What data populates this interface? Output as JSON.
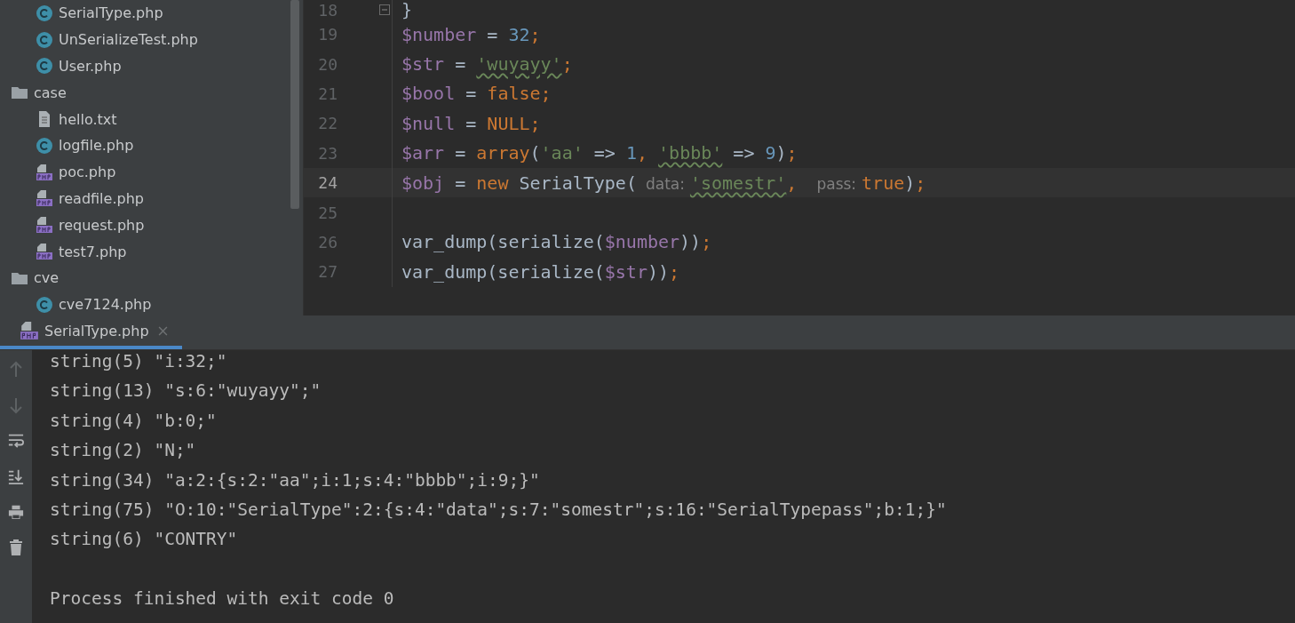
{
  "project_tree": [
    {
      "name": "SerialType.php",
      "kind": "class"
    },
    {
      "name": "UnSerializeTest.php",
      "kind": "class"
    },
    {
      "name": "User.php",
      "kind": "class"
    },
    {
      "name": "case",
      "kind": "folder",
      "children": [
        {
          "name": "hello.txt",
          "kind": "text"
        },
        {
          "name": "logfile.php",
          "kind": "class"
        },
        {
          "name": "poc.php",
          "kind": "php"
        },
        {
          "name": "readfile.php",
          "kind": "php"
        },
        {
          "name": "request.php",
          "kind": "php"
        },
        {
          "name": "test7.php",
          "kind": "php"
        }
      ]
    },
    {
      "name": "cve",
      "kind": "folder",
      "children": [
        {
          "name": "cve7124.php",
          "kind": "class"
        }
      ]
    }
  ],
  "editor": {
    "lines": [
      {
        "number": "18",
        "current": false,
        "tokens": [
          {
            "kind": "op",
            "text": "}"
          }
        ]
      },
      {
        "number": "19",
        "current": false,
        "tokens": [
          {
            "kind": "var",
            "text": "$number"
          },
          {
            "kind": "op",
            "text": " = "
          },
          {
            "kind": "num",
            "text": "32"
          },
          {
            "kind": "kw",
            "text": ";"
          }
        ]
      },
      {
        "number": "20",
        "current": false,
        "tokens": [
          {
            "kind": "var",
            "text": "$str"
          },
          {
            "kind": "op",
            "text": " = "
          },
          {
            "kind": "str",
            "text": "'wuyayy'",
            "typo": true
          },
          {
            "kind": "kw",
            "text": ";"
          }
        ]
      },
      {
        "number": "21",
        "current": false,
        "tokens": [
          {
            "kind": "var",
            "text": "$bool"
          },
          {
            "kind": "op",
            "text": " = "
          },
          {
            "kind": "kw",
            "text": "false;"
          }
        ]
      },
      {
        "number": "22",
        "current": false,
        "tokens": [
          {
            "kind": "var",
            "text": "$null"
          },
          {
            "kind": "op",
            "text": " = "
          },
          {
            "kind": "kw",
            "text": "NULL;"
          }
        ]
      },
      {
        "number": "23",
        "current": false,
        "tokens": [
          {
            "kind": "var",
            "text": "$arr"
          },
          {
            "kind": "op",
            "text": " = "
          },
          {
            "kind": "kw",
            "text": "array"
          },
          {
            "kind": "op",
            "text": "("
          },
          {
            "kind": "str",
            "text": "'aa'"
          },
          {
            "kind": "op",
            "text": " => "
          },
          {
            "kind": "num",
            "text": "1"
          },
          {
            "kind": "kw",
            "text": ", "
          },
          {
            "kind": "str",
            "text": "'bbbb'",
            "typo": true
          },
          {
            "kind": "op",
            "text": " => "
          },
          {
            "kind": "num",
            "text": "9"
          },
          {
            "kind": "op",
            "text": ")"
          },
          {
            "kind": "kw",
            "text": ";"
          }
        ]
      },
      {
        "number": "24",
        "current": true,
        "tokens": [
          {
            "kind": "var",
            "text": "$obj"
          },
          {
            "kind": "op",
            "text": " = "
          },
          {
            "kind": "kw",
            "text": "new "
          },
          {
            "kind": "op",
            "text": "SerialType("
          },
          {
            "kind": "hint",
            "text": "data:"
          },
          {
            "kind": "str",
            "text": "'somestr'",
            "typo": true
          },
          {
            "kind": "kw",
            "text": ", "
          },
          {
            "kind": "hint",
            "text": "pass:"
          },
          {
            "kind": "kw",
            "text": "true"
          },
          {
            "kind": "op",
            "text": ")"
          },
          {
            "kind": "kw",
            "text": ";"
          }
        ]
      },
      {
        "number": "25",
        "current": false
      },
      {
        "number": "26",
        "current": false,
        "tokens": [
          {
            "kind": "op",
            "text": "var_dump(serialize("
          },
          {
            "kind": "var",
            "text": "$number"
          },
          {
            "kind": "op",
            "text": "))"
          },
          {
            "kind": "kw",
            "text": ";"
          }
        ]
      },
      {
        "number": "27",
        "current": false,
        "tokens": [
          {
            "kind": "op",
            "text": "var_dump(serialize("
          },
          {
            "kind": "var",
            "text": "$str"
          },
          {
            "kind": "op",
            "text": "))"
          },
          {
            "kind": "kw",
            "text": ";"
          }
        ]
      }
    ]
  },
  "run_panel": {
    "tabs": [
      {
        "label": "SerialType.php",
        "selected": true
      }
    ],
    "output": [
      "string(5) \"i:32;\"",
      "string(13) \"s:6:\"wuyayy\";\"",
      "string(4) \"b:0;\"",
      "string(2) \"N;\"",
      "string(34) \"a:2:{s:2:\"aa\";i:1;s:4:\"bbbb\";i:9;}\"",
      "string(75) \"O:10:\"SerialType\":2:{s:4:\"data\";s:7:\"somestr\";s:16:\"SerialTypepass\";b:1;}\"",
      "string(6) \"CONTRY\""
    ],
    "exit_message": "Process finished with exit code 0"
  }
}
